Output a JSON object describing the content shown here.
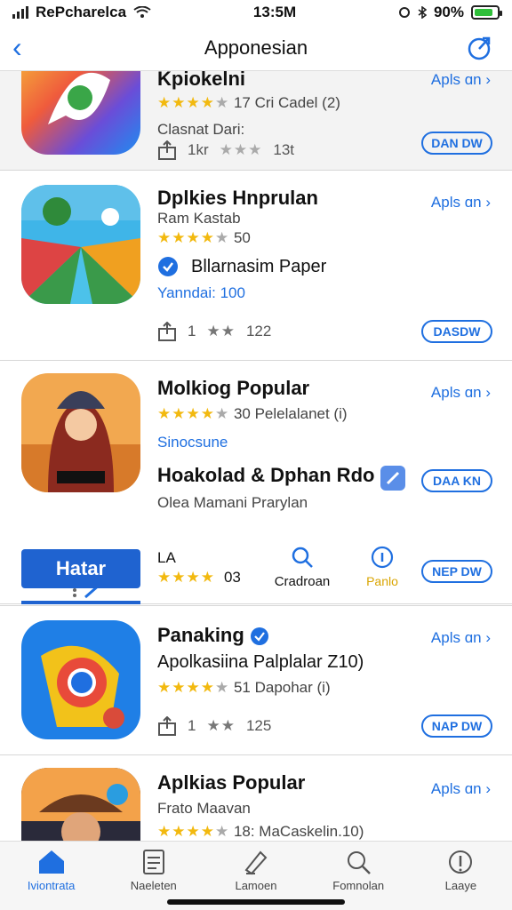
{
  "status": {
    "carrier": "RePcharelca",
    "time": "13:5M",
    "battery": "90%"
  },
  "nav": {
    "title": "Apponesian"
  },
  "apps": [
    {
      "name": "Kpiokelni",
      "rating_text": "17 Cri Cadel (2)",
      "line2": "Clasnat Dari:",
      "stat_text": "1kr",
      "count": "13t",
      "aside": "Apls ɑn",
      "button": "DAN DW"
    },
    {
      "name": "Dplkies Hnprulan",
      "subtitle": "Ram Kastab",
      "rating": "50",
      "verified_label": "Bllarnasim Paper",
      "line3": "Yanndai: 100",
      "stat_count": "1",
      "reviews": "122",
      "aside": "Apls ɑn",
      "button": "DASDW"
    },
    {
      "name": "Molkiog Popular",
      "rating_text": "30 Pelelalanet (i)",
      "tag": "Sinocsune",
      "feature_title": "Hoakolad & Dphan Rdo",
      "feature_sub": "Olea Mamani Prarylan",
      "primary_label": "Hatar",
      "badge": "LA",
      "rating_count": "03",
      "crad_label": "Cradroan",
      "info_label": "Panlo",
      "aside": "Apls ɑn",
      "button_top": "DAA KN",
      "button_bottom": "NEP DW"
    },
    {
      "name": "Panaking",
      "subtitle": "Apolkasiina Palplalar Z10)",
      "rating_text": "51 Dapohar (i)",
      "stat_count": "1",
      "reviews": "125",
      "aside": "Apls ɑn",
      "button": "NAP DW"
    },
    {
      "name": "Aplkias Popular",
      "subtitle": "Frato Maavan",
      "rating_text": "18: MaCaskelin.10)",
      "aside": "Apls ɑn"
    }
  ],
  "tabs": [
    {
      "label": "Iviontrata",
      "icon": "home-icon"
    },
    {
      "label": "Naeleten",
      "icon": "list-icon"
    },
    {
      "label": "Lamoen",
      "icon": "pen-icon"
    },
    {
      "label": "Fomnolan",
      "icon": "search-icon"
    },
    {
      "label": "Laaye",
      "icon": "info-icon"
    }
  ],
  "colors": {
    "accent": "#1f6fe0",
    "star": "#f2b90f"
  }
}
